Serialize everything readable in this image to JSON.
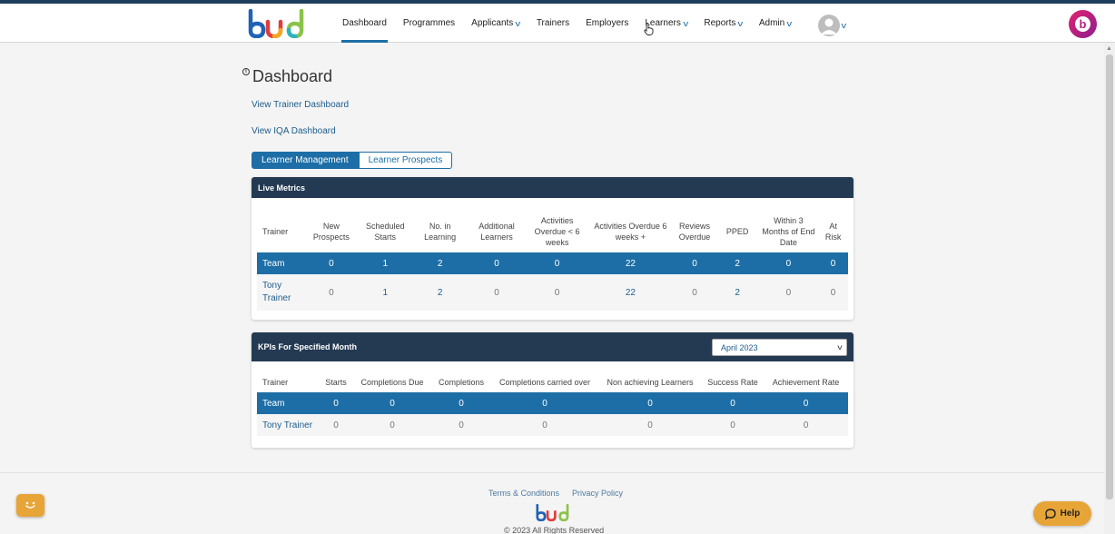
{
  "brand": {
    "logo_text": "bud",
    "colors": {
      "nav_dark": "#243a52",
      "accent": "#1d6ea6",
      "help": "#e7a537"
    }
  },
  "nav": {
    "items": [
      {
        "label": "Dashboard",
        "dropdown": false,
        "active": true
      },
      {
        "label": "Programmes",
        "dropdown": false
      },
      {
        "label": "Applicants",
        "dropdown": true
      },
      {
        "label": "Trainers",
        "dropdown": false
      },
      {
        "label": "Employers",
        "dropdown": false
      },
      {
        "label": "Learners",
        "dropdown": true
      },
      {
        "label": "Reports",
        "dropdown": true
      },
      {
        "label": "Admin",
        "dropdown": true
      }
    ],
    "chevron_glyph": "v",
    "user_icon": "user-avatar-icon",
    "brand_badge_letter": "b"
  },
  "page": {
    "info_glyph": "i",
    "title": "Dashboard",
    "links": {
      "trainer": "View Trainer Dashboard",
      "iqa": "View IQA Dashboard"
    },
    "tabs": {
      "management": "Learner Management",
      "prospects": "Learner Prospects"
    }
  },
  "live_metrics": {
    "title": "Live Metrics",
    "headers": [
      "Trainer",
      "New Prospects",
      "Scheduled Starts",
      "No. in Learning",
      "Additional Learners",
      "Activities Overdue < 6 weeks",
      "Activities Overdue 6 weeks +",
      "Reviews Overdue",
      "PPED",
      "Within 3 Months of End Date",
      "At Risk"
    ],
    "team": [
      "Team",
      "0",
      "1",
      "2",
      "0",
      "0",
      "22",
      "0",
      "2",
      "0",
      "0"
    ],
    "trainer": [
      "Tony Trainer",
      "0",
      "1",
      "2",
      "0",
      "0",
      "22",
      "0",
      "2",
      "0",
      "0"
    ]
  },
  "kpis": {
    "title": "KPIs For Specified Month",
    "month": "April 2023",
    "headers": [
      "Trainer",
      "Starts",
      "Completions Due",
      "Completions",
      "Completions carried over",
      "Non achieving Learners",
      "Success Rate",
      "Achievement Rate"
    ],
    "team": [
      "Team",
      "0",
      "0",
      "0",
      "0",
      "0",
      "0",
      "0"
    ],
    "trainer": [
      "Tony Trainer",
      "0",
      "0",
      "0",
      "0",
      "0",
      "0",
      "0"
    ]
  },
  "footer": {
    "terms": "Terms & Conditions",
    "privacy": "Privacy Policy",
    "copyright": "© 2023 All Rights Reserved"
  },
  "help": {
    "label": "Help"
  }
}
